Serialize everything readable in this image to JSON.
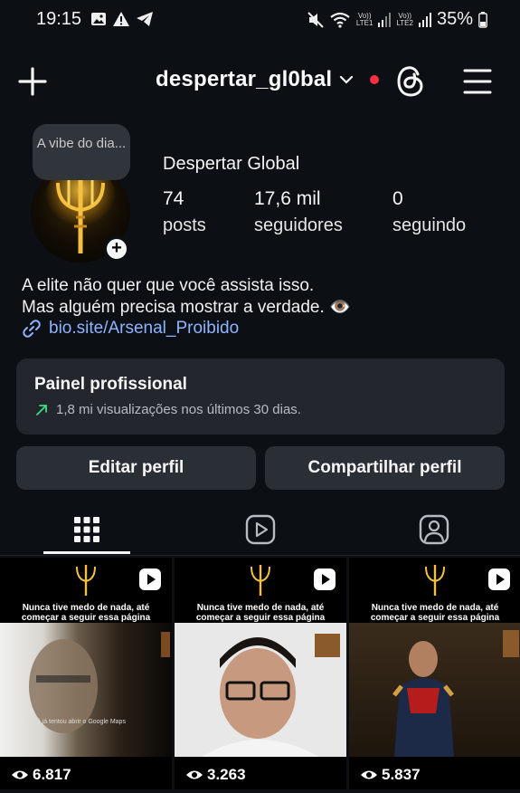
{
  "status_bar": {
    "time": "19:15",
    "battery": "35%",
    "sim1": "LTE1",
    "sim2": "LTE2",
    "volte": "Vo))"
  },
  "header": {
    "username": "despertar_gl0bal",
    "icons": [
      "plus-icon",
      "chevron-down-icon",
      "threads-icon",
      "menu-icon"
    ],
    "notification_dot_color": "#ff3040"
  },
  "profile": {
    "note": "A vibe do dia...",
    "display_name": "Despertar Global",
    "stats": [
      {
        "value": "74",
        "label": "posts"
      },
      {
        "value": "17,6 mil",
        "label": "seguidores"
      },
      {
        "value": "0",
        "label": "seguindo"
      }
    ],
    "bio_line1": "A elite não quer que você assista isso.",
    "bio_line2": "Mas alguém precisa mostrar a verdade. 👁️",
    "link": "bio.site/Arsenal_Proibido",
    "add_story": "+"
  },
  "pro_panel": {
    "title": "Painel profissional",
    "subtitle": "1,8 mi visualizações nos últimos 30 dias."
  },
  "buttons": {
    "edit": "Editar perfil",
    "share": "Compartilhar perfil"
  },
  "tabs": [
    {
      "icon": "grid-icon",
      "active": true
    },
    {
      "icon": "reels-icon",
      "active": false
    },
    {
      "icon": "tagged-icon",
      "active": false
    }
  ],
  "posts": [
    {
      "caption_line1": "Nunca tive medo de nada, até",
      "caption_line2": "começar a seguir essa página",
      "overlay": "você já tentou abrir o Google Maps",
      "views": "6.817"
    },
    {
      "caption_line1": "Nunca tive medo de nada, até",
      "caption_line2": "começar a seguir essa página",
      "overlay": "",
      "views": "3.263"
    },
    {
      "caption_line1": "Nunca tive medo de nada, até",
      "caption_line2": "começar a seguir essa página",
      "overlay": "",
      "views": "5.837"
    }
  ],
  "colors": {
    "background": "#0c0f14",
    "panel": "#23272d",
    "button": "#2a2f35",
    "link": "#8fb4ff",
    "trend_arrow": "#3ddc84"
  }
}
